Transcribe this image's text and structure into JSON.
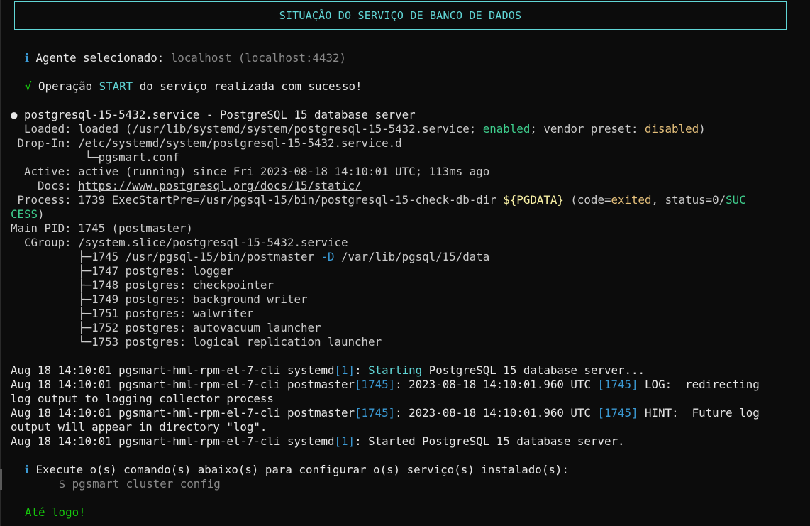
{
  "banner": {
    "title": "SITUAÇÃO DO SERVIÇO DE BANCO DE DADOS"
  },
  "agent": {
    "icon": "ℹ",
    "label": "Agente selecionado: ",
    "value": "localhost (localhost:4432)"
  },
  "operation": {
    "icon": "√",
    "before": "Operação ",
    "op": "START",
    "after": " do serviço realizada com sucesso!"
  },
  "status": {
    "bullet": "●",
    "service_line": " postgresql-15-5432.service - PostgreSQL 15 database server",
    "loaded_a": "  Loaded: loaded (/usr/lib/systemd/system/postgresql-15-5432.service; ",
    "loaded_enabled": "enabled",
    "loaded_b": "; vendor preset: ",
    "loaded_disabled": "disabled",
    "loaded_c": ")",
    "dropin_a": " Drop-In: /etc/systemd/system/postgresql-15-5432.service.d",
    "dropin_b": "           └─pgsmart.conf",
    "active": "  Active: active (running) since Fri 2023-08-18 14:10:01 UTC; 113ms ago",
    "docs_label": "    Docs: ",
    "docs_url": "https://www.postgresql.org/docs/15/static/",
    "process_a": " Process: 1739 ExecStartPre=/usr/pgsql-15/bin/postgresql-15-check-db-dir ",
    "process_var": "${PGDATA}",
    "process_b": " (code=",
    "process_exited": "exited",
    "process_c": ", status=0/",
    "process_succ1": "SUC",
    "process_succ2": "CESS",
    "process_d": ")",
    "mainpid": "Main PID: 1745 (postmaster)",
    "cgroup": "  CGroup: /system.slice/postgresql-15-5432.service",
    "tree_first_a": "          ├─1745 /usr/pgsql-15/bin/postmaster ",
    "tree_first_flag": "-D",
    "tree_first_b": " /var/lib/pgsql/15/data",
    "tree": [
      "          ├─1747 postgres: logger",
      "          ├─1748 postgres: checkpointer",
      "          ├─1749 postgres: background writer",
      "          ├─1751 postgres: walwriter",
      "          ├─1752 postgres: autovacuum launcher",
      "          └─1753 postgres: logical replication launcher"
    ]
  },
  "logs": {
    "prefix": "Aug 18 14:10:01 pgsmart-hml-rpm-el-7-cli ",
    "l1_proc": "systemd",
    "l1_pid": "[1]",
    "l1_sep": ": ",
    "l1_starting": "Starting",
    "l1_rest": " PostgreSQL 15 database server...",
    "l2_proc": "postmaster",
    "l2_pid": "[1745]",
    "l2_mid": ": 2023-08-18 14:10:01.960 UTC ",
    "l2_pid2": "[1745]",
    "l2_rest": " LOG:  redirecting",
    "l2_cont": "log output to logging collector process",
    "l3_proc": "postmaster",
    "l3_pid": "[1745]",
    "l3_mid": ": 2023-08-18 14:10:01.960 UTC ",
    "l3_pid2": "[1745]",
    "l3_rest": " HINT:  Future log",
    "l3_cont": "output will appear in directory \"log\".",
    "l4_proc": "systemd",
    "l4_pid": "[1]",
    "l4_rest": ": Started PostgreSQL 15 database server."
  },
  "hint": {
    "icon": "ℹ",
    "text": " Execute o(s) comando(s) abaixo(s) para configurar o(s) serviço(s) instalado(s):",
    "command": "     $ pgsmart cluster config"
  },
  "goodbye": "Até logo!",
  "colors": {
    "background": "#0c0c0c",
    "text": "#cccccc",
    "cyan": "#61d6d6",
    "blue": "#3b9bd6",
    "green": "#16c60c",
    "yellow": "#f9f1a5"
  }
}
